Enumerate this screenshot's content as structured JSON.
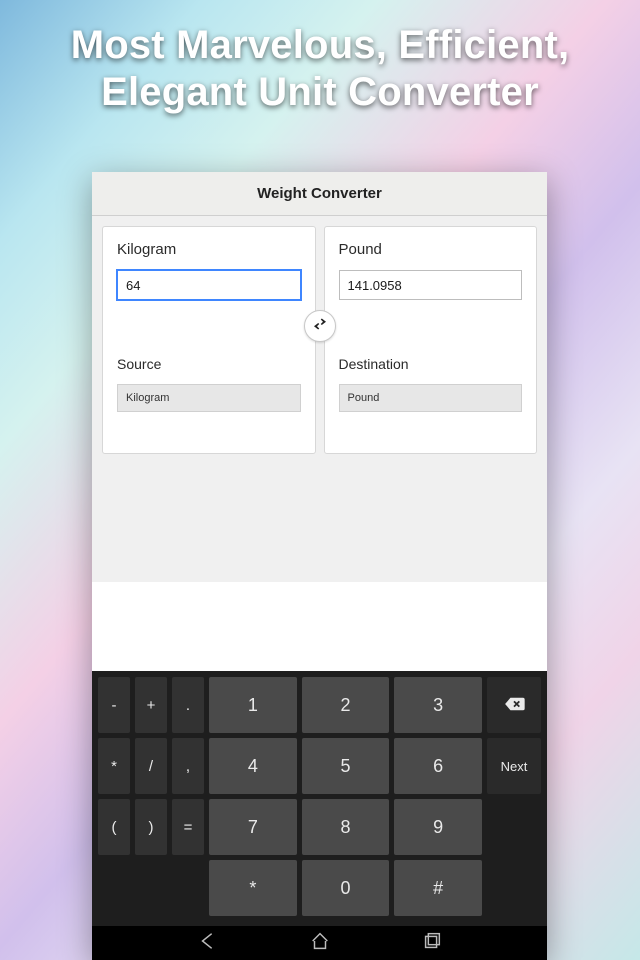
{
  "promo": {
    "line1": "Most Marvelous, Efficient,",
    "line2": "Elegant Unit Converter"
  },
  "titlebar": {
    "title": "Weight Converter"
  },
  "converter": {
    "left": {
      "unit_label": "Kilogram",
      "value": "64",
      "sd_label": "Source",
      "picker_value": "Kilogram"
    },
    "right": {
      "unit_label": "Pound",
      "value": "141.0958",
      "sd_label": "Destination",
      "picker_value": "Pound"
    },
    "swap_icon": "swap-horiz-icon"
  },
  "keyboard": {
    "rows": [
      [
        {
          "t": "-",
          "v": "sym"
        },
        {
          "t": "+",
          "v": "sym"
        },
        {
          "t": ".",
          "v": "sym"
        },
        {
          "t": "1",
          "v": "num"
        },
        {
          "t": "2",
          "v": "num"
        },
        {
          "t": "3",
          "v": "num"
        },
        {
          "t": "⌫",
          "v": "act",
          "name": "backspace-key"
        }
      ],
      [
        {
          "t": "*",
          "v": "sym"
        },
        {
          "t": "/",
          "v": "sym"
        },
        {
          "t": ",",
          "v": "sym"
        },
        {
          "t": "4",
          "v": "num"
        },
        {
          "t": "5",
          "v": "num"
        },
        {
          "t": "6",
          "v": "num"
        },
        {
          "t": "Next",
          "v": "act",
          "name": "next-key"
        }
      ],
      [
        {
          "t": "(",
          "v": "sym"
        },
        {
          "t": ")",
          "v": "sym"
        },
        {
          "t": "=",
          "v": "sym"
        },
        {
          "t": "7",
          "v": "num"
        },
        {
          "t": "8",
          "v": "num"
        },
        {
          "t": "9",
          "v": "num"
        },
        {
          "t": "",
          "v": "act",
          "name": "blank-key"
        }
      ],
      [
        {
          "t": "",
          "v": "sym"
        },
        {
          "t": "",
          "v": "sym"
        },
        {
          "t": "",
          "v": "sym"
        },
        {
          "t": "*",
          "v": "num"
        },
        {
          "t": "0",
          "v": "num"
        },
        {
          "t": "#",
          "v": "num"
        },
        {
          "t": "",
          "v": "act",
          "name": "blank-key2"
        }
      ]
    ]
  },
  "navbar": {
    "back": "back-icon",
    "home": "home-icon",
    "recent": "recent-icon"
  }
}
